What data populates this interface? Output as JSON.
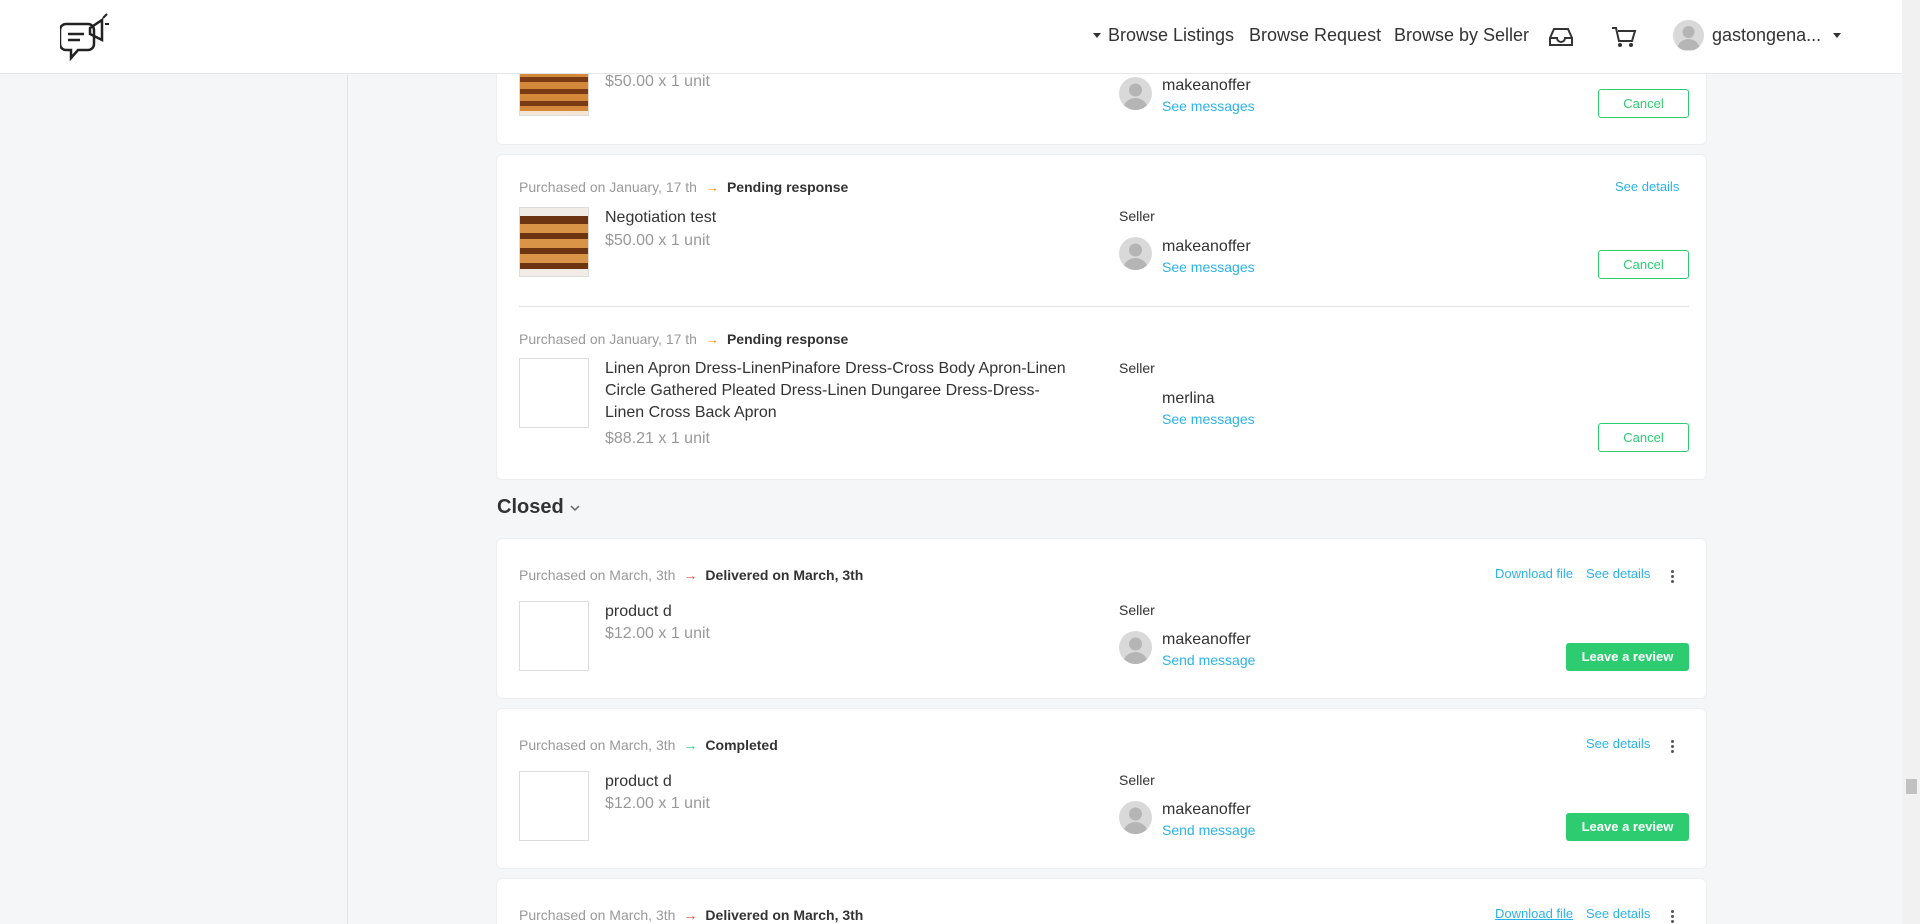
{
  "header": {
    "nav": {
      "browse_listings": "Browse Listings",
      "browse_request": "Browse Request",
      "browse_by_seller": "Browse by Seller"
    },
    "username": "gastongena..."
  },
  "sections": {
    "closed_title": "Closed"
  },
  "orders": [
    {
      "purchase": "",
      "status": "",
      "title": "",
      "price": "$50.00 x 1 unit",
      "seller_label": "",
      "seller": "makeanoffer",
      "seller_link": "See messages",
      "action": "Cancel"
    },
    {
      "purchase": "Purchased on January, 17 th",
      "status": "Pending response",
      "title": "Negotiation test",
      "price": "$50.00 x 1 unit",
      "seller_label": "Seller",
      "seller": "makeanoffer",
      "seller_link": "See messages",
      "action": "Cancel",
      "details": "See details"
    },
    {
      "purchase": "Purchased on January, 17 th",
      "status": "Pending response",
      "title": "Linen Apron Dress-LinenPinafore Dress-Cross Body Apron-Linen Circle Gathered Pleated Dress-Linen Dungaree Dress-Dress-Linen Cross Back Apron",
      "price": "$88.21 x 1 unit",
      "seller_label": "Seller",
      "seller": "merlina",
      "seller_link": "See messages",
      "action": "Cancel"
    },
    {
      "purchase": "Purchased on March, 3th",
      "status": "Delivered on March, 3th",
      "title": "product d",
      "price": "$12.00 x 1 unit",
      "seller_label": "Seller",
      "seller": "makeanoffer",
      "seller_link": "Send message",
      "action": "Leave a review",
      "download": "Download file",
      "details": "See details"
    },
    {
      "purchase": "Purchased on March, 3th",
      "status": "Completed",
      "title": "product d",
      "price": "$12.00 x 1 unit",
      "seller_label": "Seller",
      "seller": "makeanoffer",
      "seller_link": "Send message",
      "action": "Leave a review",
      "details": "See details"
    },
    {
      "purchase": "Purchased on March, 3th",
      "status": "Delivered on March, 3th",
      "download": "Download file",
      "details": "See details"
    }
  ],
  "colors": {
    "accent": "#2ecc71",
    "link": "#2bb3e8",
    "pending_arrow": "#f5a623",
    "delivered_arrow": "#e8453c",
    "completed_arrow": "#2ecc71"
  }
}
